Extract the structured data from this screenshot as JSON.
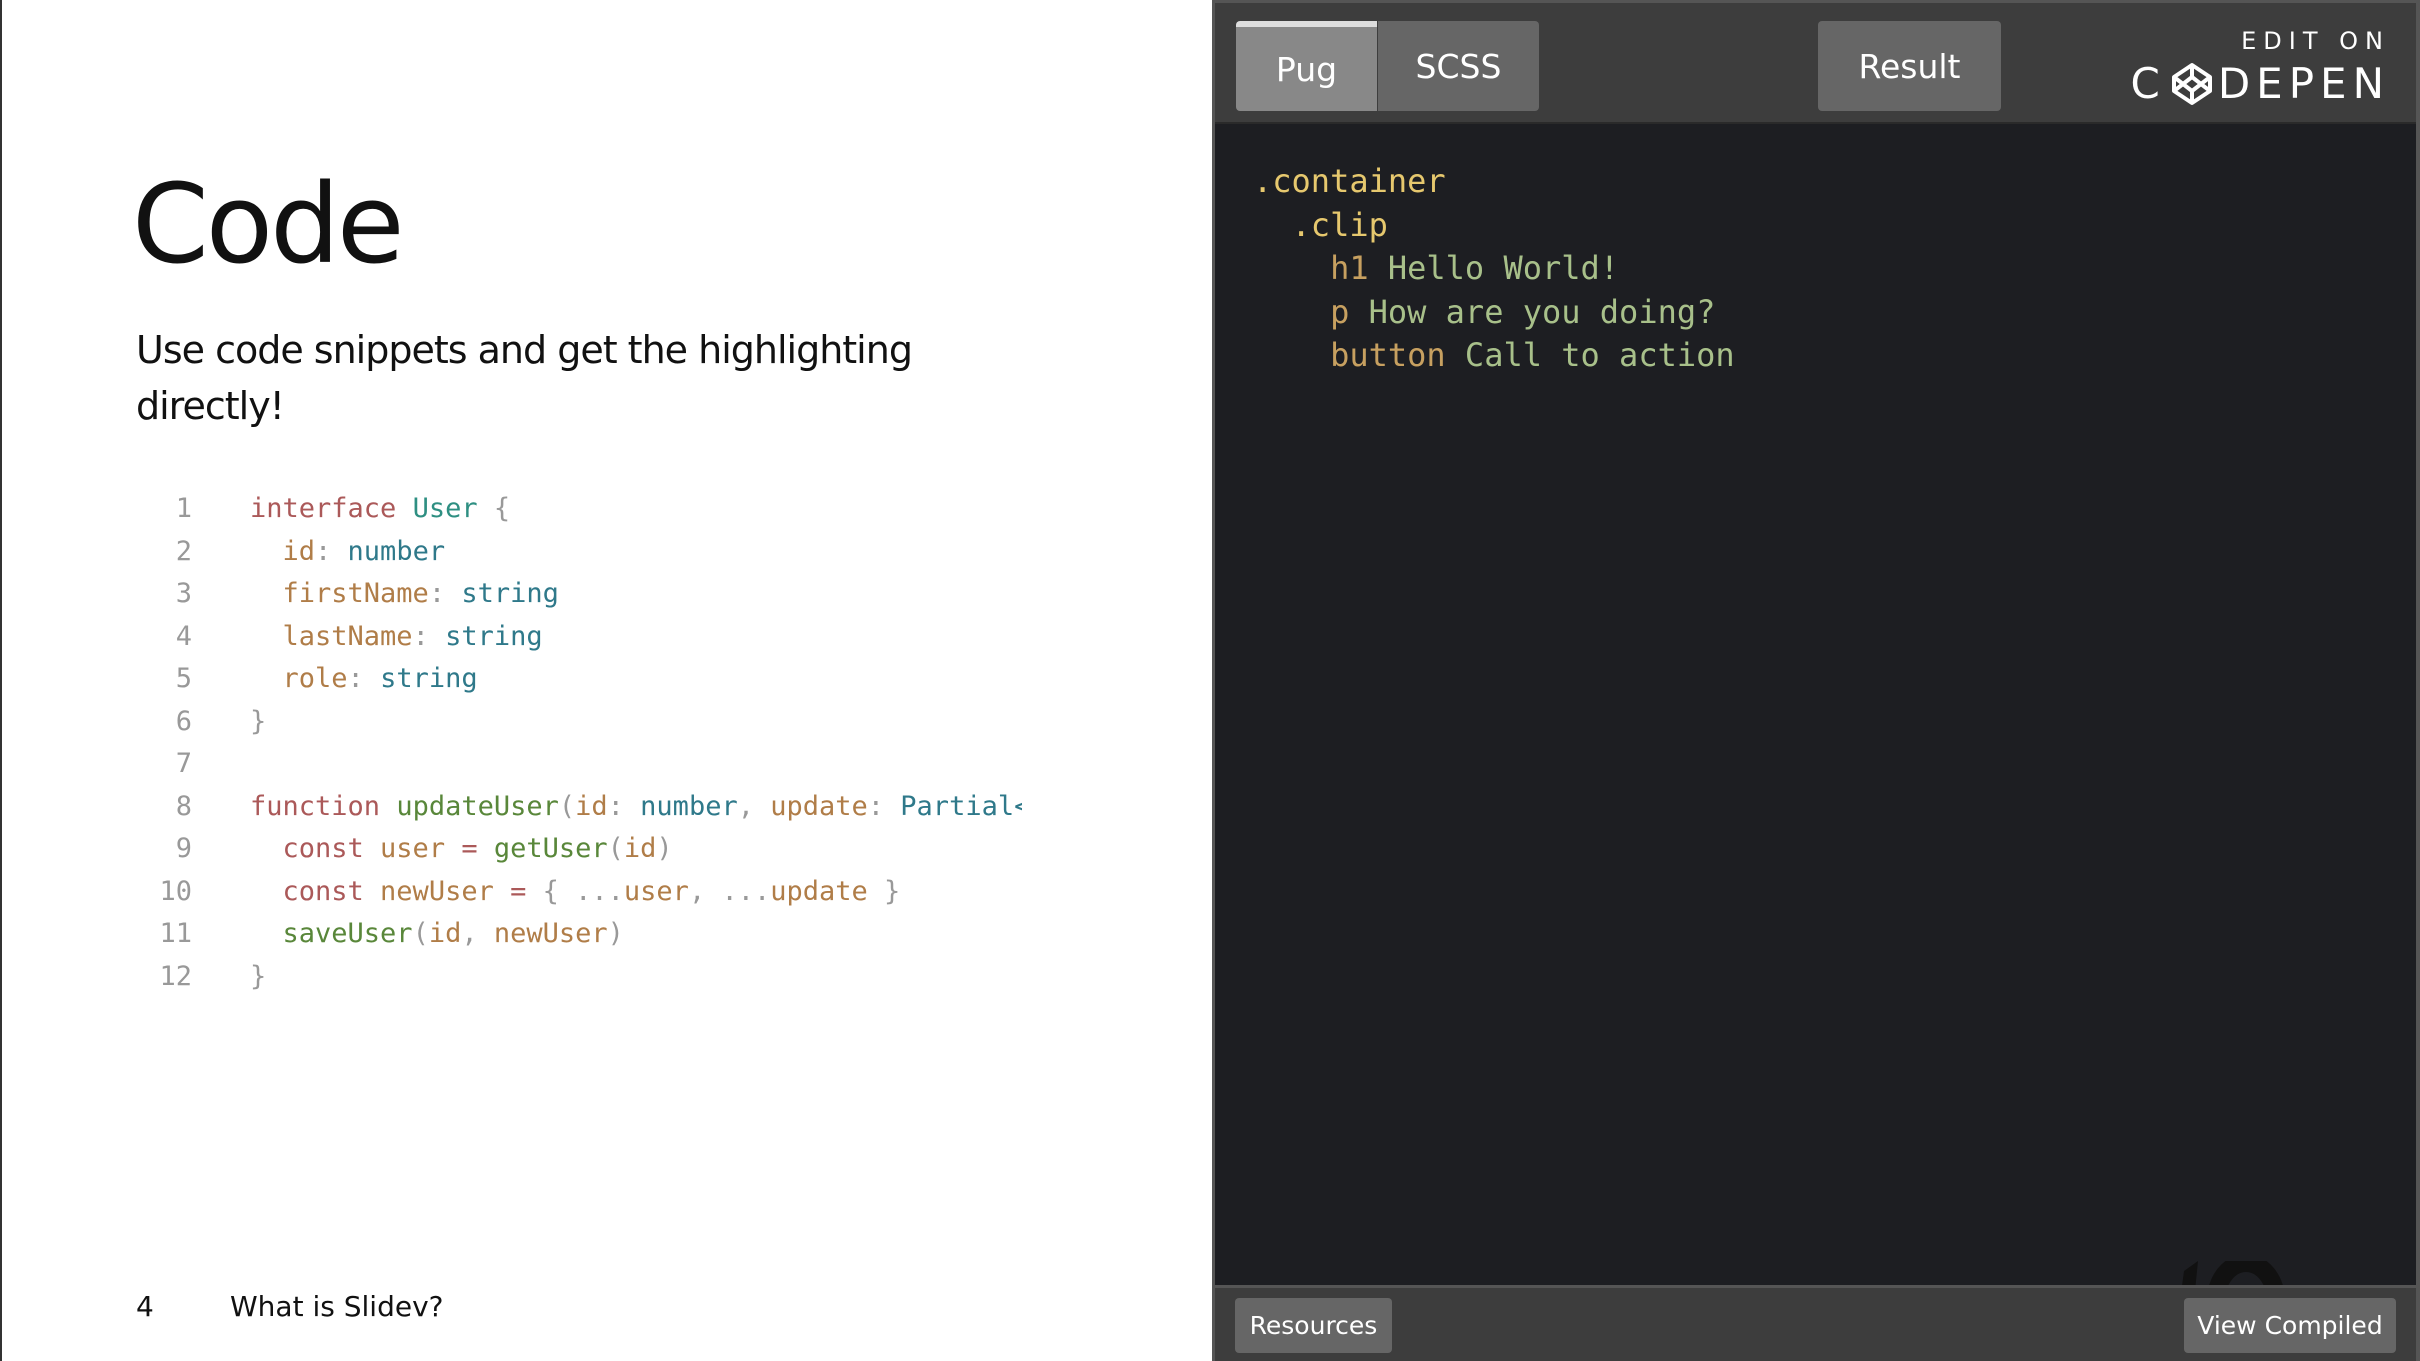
{
  "slide": {
    "title": "Code",
    "subtitle": "Use code snippets and get the highlighting directly!",
    "code_lines": [
      [
        [
          "interface ",
          "kw"
        ],
        [
          "User ",
          "ty"
        ],
        [
          "{",
          "pu"
        ]
      ],
      [
        [
          "  id",
          "pr"
        ],
        [
          ": ",
          "pu"
        ],
        [
          "number",
          "tn"
        ]
      ],
      [
        [
          "  firstName",
          "pr"
        ],
        [
          ": ",
          "pu"
        ],
        [
          "string",
          "tn"
        ]
      ],
      [
        [
          "  lastName",
          "pr"
        ],
        [
          ": ",
          "pu"
        ],
        [
          "string",
          "tn"
        ]
      ],
      [
        [
          "  role",
          "pr"
        ],
        [
          ": ",
          "pu"
        ],
        [
          "string",
          "tn"
        ]
      ],
      [
        [
          "}",
          "pu"
        ]
      ],
      [],
      [
        [
          "function ",
          "kw"
        ],
        [
          "updateUser",
          "fn"
        ],
        [
          "(",
          "pu"
        ],
        [
          "id",
          "vr"
        ],
        [
          ": ",
          "pu"
        ],
        [
          "number",
          "tn"
        ],
        [
          ", ",
          "pu"
        ],
        [
          "update",
          "vr"
        ],
        [
          ": ",
          "pu"
        ],
        [
          "Partial<User>)",
          "tn"
        ]
      ],
      [
        [
          "  const ",
          "kw"
        ],
        [
          "user ",
          "vr"
        ],
        [
          "= ",
          "kw"
        ],
        [
          "getUser",
          "fn"
        ],
        [
          "(",
          "pu"
        ],
        [
          "id",
          "vr"
        ],
        [
          ")",
          "pu"
        ]
      ],
      [
        [
          "  const ",
          "kw"
        ],
        [
          "newUser ",
          "vr"
        ],
        [
          "= ",
          "kw"
        ],
        [
          "{ ",
          "pu"
        ],
        [
          "...",
          "pu"
        ],
        [
          "user",
          "vr"
        ],
        [
          ", ",
          "pu"
        ],
        [
          "...",
          "pu"
        ],
        [
          "update ",
          "vr"
        ],
        [
          "}",
          "pu"
        ]
      ],
      [
        [
          "  saveUser",
          "fn"
        ],
        [
          "(",
          "pu"
        ],
        [
          "id",
          "vr"
        ],
        [
          ", ",
          "pu"
        ],
        [
          "newUser",
          "vr"
        ],
        [
          ")",
          "pu"
        ]
      ],
      [
        [
          "}",
          "pu"
        ]
      ]
    ],
    "page_number": "4",
    "footer_text": "What is Slidev?"
  },
  "codepen": {
    "tabs": [
      "Pug",
      "SCSS"
    ],
    "active_tab": "Pug",
    "result_label": "Result",
    "edit_on": "EDIT ON",
    "logo": "CODEPEN",
    "code_lines": [
      [
        [
          ".container",
          "pc"
        ]
      ],
      [
        [
          "  .clip",
          "pc"
        ]
      ],
      [
        [
          "    h1 ",
          "pt"
        ],
        [
          "Hello World!",
          "px"
        ]
      ],
      [
        [
          "    p ",
          "pt"
        ],
        [
          "How are you doing?",
          "px"
        ]
      ],
      [
        [
          "    button ",
          "pt"
        ],
        [
          "Call to action",
          "px"
        ]
      ]
    ],
    "resources_label": "Resources",
    "view_compiled_label": "View Compiled"
  }
}
